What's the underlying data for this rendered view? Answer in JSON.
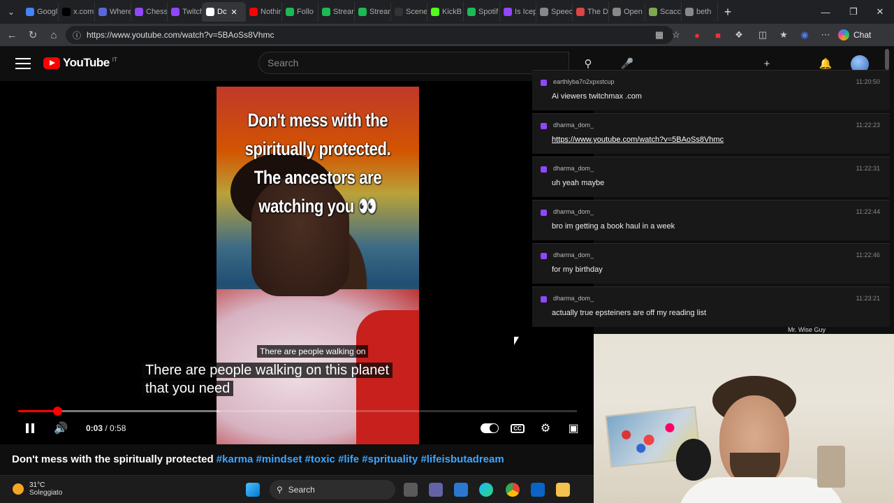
{
  "browser": {
    "tabs": [
      {
        "label": "Googl",
        "color": "#4285f4"
      },
      {
        "label": "x.com",
        "color": "#000000"
      },
      {
        "label": "Where",
        "color": "#5a67d8"
      },
      {
        "label": "Chess",
        "color": "#9146ff"
      },
      {
        "label": "Twitch",
        "color": "#9146ff"
      },
      {
        "label": "Dc",
        "color": "#ffffff",
        "active": true
      },
      {
        "label": "Nothir",
        "color": "#ff0000"
      },
      {
        "label": "Follo",
        "color": "#1db954"
      },
      {
        "label": "Strean",
        "color": "#1db954"
      },
      {
        "label": "Strean",
        "color": "#1db954"
      },
      {
        "label": "Scene",
        "color": "#333333"
      },
      {
        "label": "KickB",
        "color": "#53fc18"
      },
      {
        "label": "Spotif",
        "color": "#1db954"
      },
      {
        "label": "Is Icep",
        "color": "#9146ff"
      },
      {
        "label": "Speec",
        "color": "#888888"
      },
      {
        "label": "The D",
        "color": "#d44"
      },
      {
        "label": "Open",
        "color": "#888888"
      },
      {
        "label": "Scacc",
        "color": "#7fa650"
      },
      {
        "label": "beth",
        "color": "#888888"
      }
    ],
    "url": "https://www.youtube.com/watch?v=5BAoSs8Vhmc",
    "chat_label": "Chat"
  },
  "youtube": {
    "logo_text": "YouTube",
    "country_code": "IT",
    "search_placeholder": "Search",
    "video": {
      "overlay_caption": "Don't mess with the spiritually protected. The ancestors are watching you 👀",
      "in_video_caption": "There are people walking on",
      "subtitle_line1": "There are people walking on this planet",
      "subtitle_line2": "that you need",
      "time_current": "0:03",
      "time_total": "0:58",
      "played_fraction": 0.07,
      "buffered_fraction": 0.36
    },
    "title": {
      "text": "Don't mess with the spiritually protected",
      "hashtags": [
        "#karma",
        "#mindset",
        "#toxic",
        "#life",
        "#sprituality",
        "#lifeisbutadream"
      ]
    }
  },
  "chat": {
    "messages": [
      {
        "user": "earthlyba7n2xpxstcup",
        "time": "11:20:50",
        "text": "Ai viewers twitchmax .com",
        "link": false
      },
      {
        "user": "dharma_dom_",
        "time": "11:22:23",
        "text": "https://www.youtube.com/watch?v=5BAoSs8Vhmc",
        "link": true
      },
      {
        "user": "dharma_dom_",
        "time": "11:22:31",
        "text": "uh yeah maybe",
        "link": false
      },
      {
        "user": "dharma_dom_",
        "time": "11:22:44",
        "text": "bro im getting a book haul in a week",
        "link": false
      },
      {
        "user": "dharma_dom_",
        "time": "11:22:46",
        "text": "for my birthday",
        "link": false
      },
      {
        "user": "dharma_dom_",
        "time": "11:23:21",
        "text": "actually true epsteiners are off my reading list",
        "link": false
      }
    ],
    "overlay_label": "Mr. Wise Guy"
  },
  "taskbar": {
    "temperature": "31°C",
    "weather": "Soleggiato",
    "search_label": "Search"
  }
}
